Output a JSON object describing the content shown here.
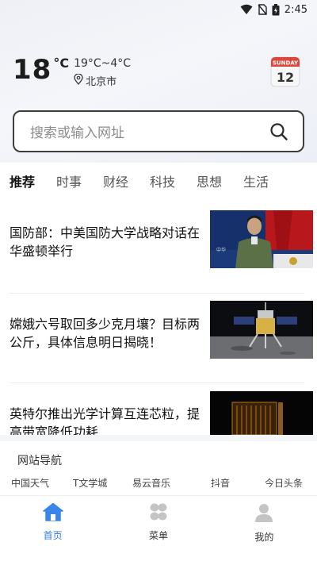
{
  "status_bar": {
    "time": "2:45"
  },
  "weather": {
    "temperature": "18",
    "degree_symbol": "°C",
    "range": "19°C~4°C",
    "location": "北京市"
  },
  "calendar": {
    "weekday": "SUNDAY",
    "day": "12"
  },
  "search": {
    "placeholder": "搜索或输入网址"
  },
  "tabs": [
    {
      "label": "推荐",
      "active": true
    },
    {
      "label": "时事",
      "active": false
    },
    {
      "label": "财经",
      "active": false
    },
    {
      "label": "科技",
      "active": false
    },
    {
      "label": "思想",
      "active": false
    },
    {
      "label": "生活",
      "active": false
    }
  ],
  "news": [
    {
      "title": "国防部：中美国防大学战略对话在华盛顿举行"
    },
    {
      "title": "嫦娥六号取回多少克月壤？目标两公斤，具体信息明日揭晓！"
    },
    {
      "title": "英特尔推出光学计算互连芯粒，提高带宽降低功耗"
    }
  ],
  "site_nav": {
    "title": "网站导航",
    "links": [
      "中国天气",
      "T文学城",
      "易云音乐",
      "抖音",
      "今日头条"
    ]
  },
  "bottom_nav": [
    {
      "label": "首页",
      "icon": "home-icon",
      "active": true
    },
    {
      "label": "菜单",
      "icon": "menu-grid-icon",
      "active": false
    },
    {
      "label": "我的",
      "icon": "profile-icon",
      "active": false
    }
  ],
  "colors": {
    "accent": "#2f7de1",
    "search_border": "#3d3d3d",
    "calendar_red": "#d9473c"
  }
}
